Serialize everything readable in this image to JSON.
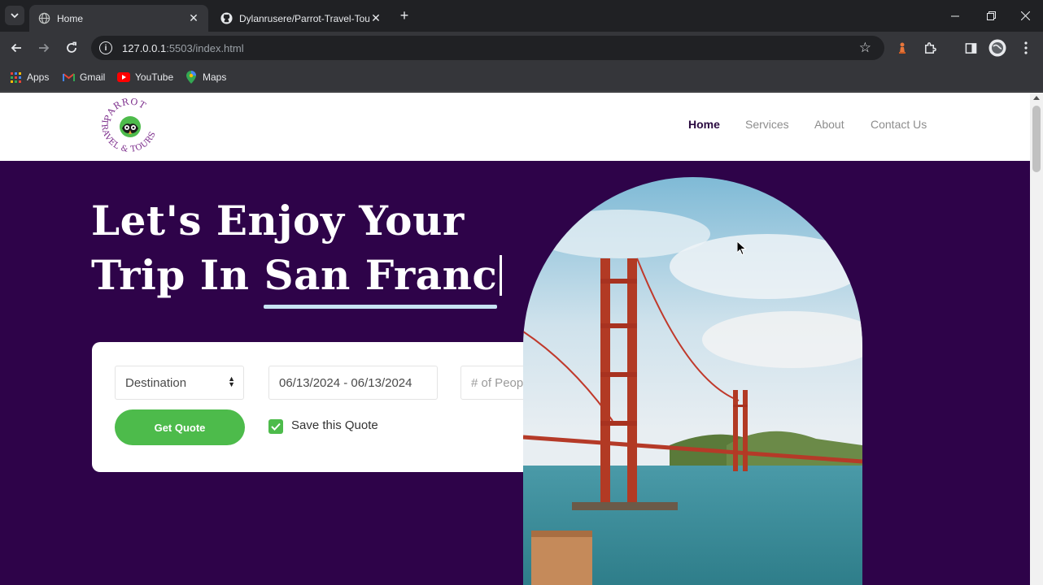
{
  "browser": {
    "tabs": [
      {
        "title": "Home",
        "active": true,
        "favicon": "globe-icon"
      },
      {
        "title": "Dylanrusere/Parrot-Travel-Tours",
        "active": false,
        "favicon": "github-icon"
      }
    ],
    "url_host": "127.0.0.1",
    "url_rest": ":5503/index.html",
    "bookmarks": [
      {
        "label": "Apps",
        "icon": "apps-grid-icon"
      },
      {
        "label": "Gmail",
        "icon": "gmail-icon"
      },
      {
        "label": "YouTube",
        "icon": "youtube-icon"
      },
      {
        "label": "Maps",
        "icon": "maps-icon"
      }
    ]
  },
  "site": {
    "logo_text_top": "PARROT",
    "logo_text_bottom": "TRAVEL & TOURS",
    "nav": [
      {
        "label": "Home",
        "active": true
      },
      {
        "label": "Services",
        "active": false
      },
      {
        "label": "About",
        "active": false
      },
      {
        "label": "Contact Us",
        "active": false
      }
    ],
    "hero": {
      "line1": "Let's Enjoy Your",
      "line2_prefix": "Trip In ",
      "line2_highlight": "San Franc"
    },
    "quote_form": {
      "destination": "Destination",
      "dates": "06/13/2024 - 06/13/2024",
      "people_placeholder": "# of People",
      "submit": "Get Quote",
      "save_label": "Save this Quote",
      "save_checked": true
    }
  },
  "colors": {
    "hero_bg": "#2e0349",
    "accent_green": "#4dbb4b",
    "underline": "#c7e3f3",
    "nav_active": "#2a0a40"
  }
}
